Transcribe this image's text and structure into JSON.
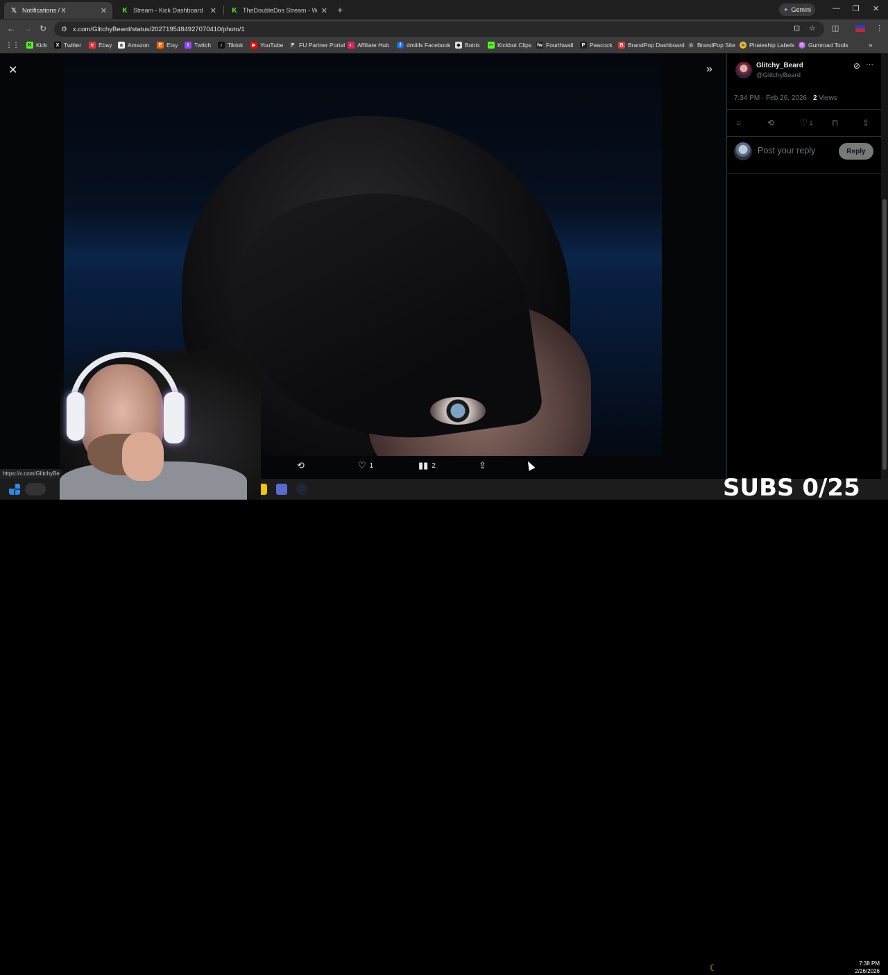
{
  "browser": {
    "tabs": [
      {
        "title": "Notifications / X",
        "favicon": "X",
        "active": true
      },
      {
        "title": "Stream - Kick Dashboard",
        "favicon": "K",
        "active": false
      },
      {
        "title": "TheDoubleDos Stream - Watch",
        "favicon": "K",
        "active": false
      }
    ],
    "new_tab": "+",
    "gemini_label": "Gemini",
    "url": "x.com/GlitchyBeard/status/2027195484927070410/photo/1",
    "bookmarks": [
      "Kick",
      "Twitter",
      "Ebay",
      "Amazon",
      "Etsy",
      "Twitch",
      "Tiktok",
      "YouTube",
      "FU Partner Portal",
      "Affiliate Hub",
      "dmiills Facebook",
      "Botrix",
      "Kickbot Clips",
      "Fourthwall",
      "Peacock",
      "BrandPop Dashboard",
      "BrandPop Site",
      "Pirateship Labels",
      "Gumroad Tools"
    ],
    "bookmark_colors": [
      "#53fc18",
      "#111111",
      "#e53238",
      "#222222",
      "#f56400",
      "#9146ff",
      "#111111",
      "#ff0000",
      "#444444",
      "#e0245e",
      "#1877f2",
      "#dddddd",
      "#53fc18",
      "#222222",
      "#222222",
      "#e03a3a",
      "#444444",
      "#f0c040",
      "#b45ce0"
    ],
    "status_url": "https://x.com/GlitchyBe"
  },
  "post": {
    "display_name": "Glitchy_Beard",
    "handle": "@GlitchyBeard",
    "time": "7:34 PM · Feb 26, 2026 · ",
    "views_count": "2",
    "views_label": " Views",
    "likes": "1",
    "reply_placeholder": "Post your reply",
    "reply_button": "Reply"
  },
  "viewer_actions": {
    "likes": "1",
    "views": "2"
  },
  "overlay": {
    "subs_text": "SUBS 0/25"
  },
  "taskbar": {
    "time": "7:38 PM",
    "date": "2/26/2026"
  }
}
